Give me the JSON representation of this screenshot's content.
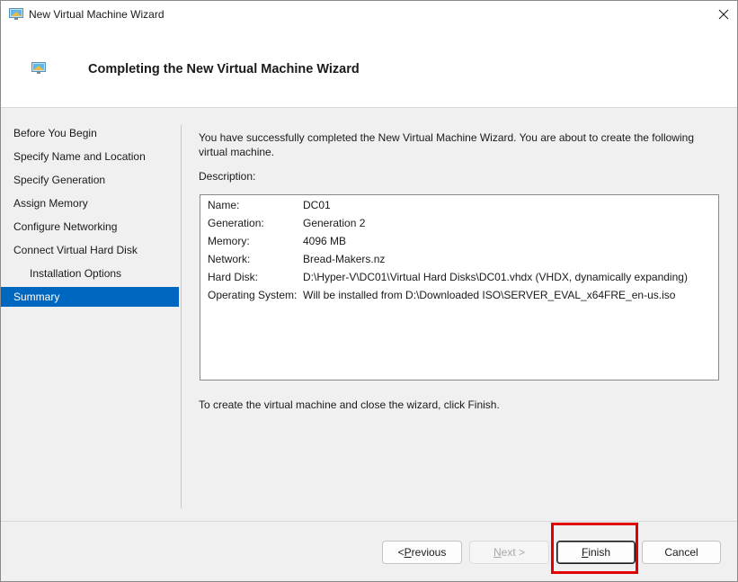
{
  "window": {
    "title": "New Virtual Machine Wizard"
  },
  "header": {
    "title": "Completing the New Virtual Machine Wizard"
  },
  "nav": {
    "items": [
      {
        "label": "Before You Begin",
        "sub": false,
        "active": false
      },
      {
        "label": "Specify Name and Location",
        "sub": false,
        "active": false
      },
      {
        "label": "Specify Generation",
        "sub": false,
        "active": false
      },
      {
        "label": "Assign Memory",
        "sub": false,
        "active": false
      },
      {
        "label": "Configure Networking",
        "sub": false,
        "active": false
      },
      {
        "label": "Connect Virtual Hard Disk",
        "sub": false,
        "active": false
      },
      {
        "label": "Installation Options",
        "sub": true,
        "active": false
      },
      {
        "label": "Summary",
        "sub": false,
        "active": true
      }
    ]
  },
  "content": {
    "intro": "You have successfully completed the New Virtual Machine Wizard. You are about to create the following virtual machine.",
    "description_label": "Description:",
    "description": [
      {
        "key": "Name:",
        "value": "DC01"
      },
      {
        "key": "Generation:",
        "value": "Generation 2"
      },
      {
        "key": "Memory:",
        "value": "4096 MB"
      },
      {
        "key": "Network:",
        "value": "Bread-Makers.nz"
      },
      {
        "key": "Hard Disk:",
        "value": "D:\\Hyper-V\\DC01\\Virtual Hard Disks\\DC01.vhdx (VHDX, dynamically expanding)"
      },
      {
        "key": "Operating System:",
        "value": "Will be installed from D:\\Downloaded ISO\\SERVER_EVAL_x64FRE_en-us.iso"
      }
    ],
    "finish_note": "To create the virtual machine and close the wizard, click Finish."
  },
  "footer": {
    "previous_prefix": "< ",
    "previous_mnemonic": "P",
    "previous_rest": "revious",
    "next_mnemonic": "N",
    "next_rest": "ext >",
    "finish_mnemonic": "F",
    "finish_rest": "inish",
    "cancel_label": "Cancel"
  },
  "colors": {
    "accent": "#0067c0",
    "highlight": "#e00000"
  },
  "icons": {
    "app": "vm-monitor-icon",
    "close": "close-icon"
  }
}
